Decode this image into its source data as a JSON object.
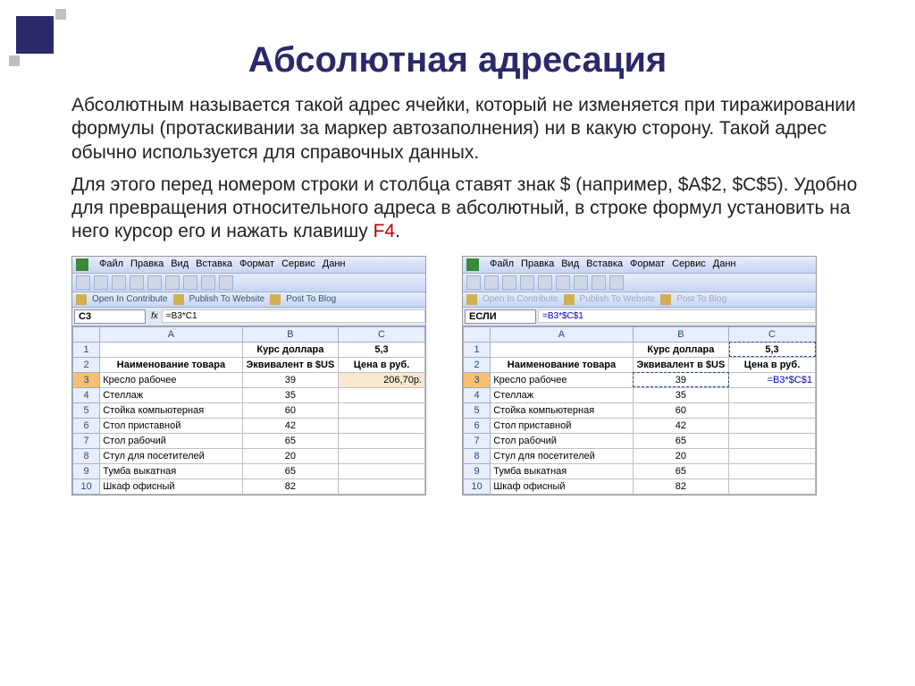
{
  "title": "Абсолютная адресация",
  "para1": "Абсолютным называется такой адрес ячейки, который не изменяется при тиражировании формулы (протаскивании за маркер автозаполнения) ни в какую сторону. Такой адрес обычно используется для справочных данных.",
  "para2_a": "Для этого перед номером строки и столбца ставят знак $ (например, $A$2, $C$5). Удобно для превращения относительного адреса в абсолютный, в строке формул установить на него курсор его и нажать клавишу  ",
  "para2_f4": "F4",
  "para2_b": ".",
  "menu": {
    "file": "Файл",
    "edit": "Правка",
    "view": "Вид",
    "insert": "Вставка",
    "format": "Формат",
    "service": "Сервис",
    "data": "Данн"
  },
  "contribute": {
    "open": "Open In Contribute",
    "publish": "Publish To Website",
    "post": "Post To Blog"
  },
  "left": {
    "namebox": "C3",
    "formula": "=B3*C1"
  },
  "right": {
    "namebox": "ЕСЛИ",
    "formula": "=B3*$C$1",
    "c3_display": "=B3*$C$1"
  },
  "headers": {
    "A": "A",
    "B": "B",
    "C": "C",
    "r1B": "Курс доллара",
    "r1C": "5,3",
    "r2A": "Наименование товара",
    "r2B": "Эквивалент в $US",
    "r2C": "Цена в руб."
  },
  "chart_data": {
    "type": "table",
    "columns": [
      "Наименование товара",
      "Эквивалент в $US",
      "Цена в руб."
    ],
    "rows": [
      {
        "row": 3,
        "name": "Кресло рабочее",
        "usd": 39,
        "rub_left": "206,70р."
      },
      {
        "row": 4,
        "name": "Стеллаж",
        "usd": 35
      },
      {
        "row": 5,
        "name": "Стойка компьютерная",
        "usd": 60
      },
      {
        "row": 6,
        "name": "Стол приставной",
        "usd": 42
      },
      {
        "row": 7,
        "name": "Стол рабочий",
        "usd": 65
      },
      {
        "row": 8,
        "name": "Стул для посетителей",
        "usd": 20
      },
      {
        "row": 9,
        "name": "Тумба выкатная",
        "usd": 65
      },
      {
        "row": 10,
        "name": "Шкаф офисный",
        "usd": 82
      }
    ],
    "exchange_rate": 5.3
  }
}
